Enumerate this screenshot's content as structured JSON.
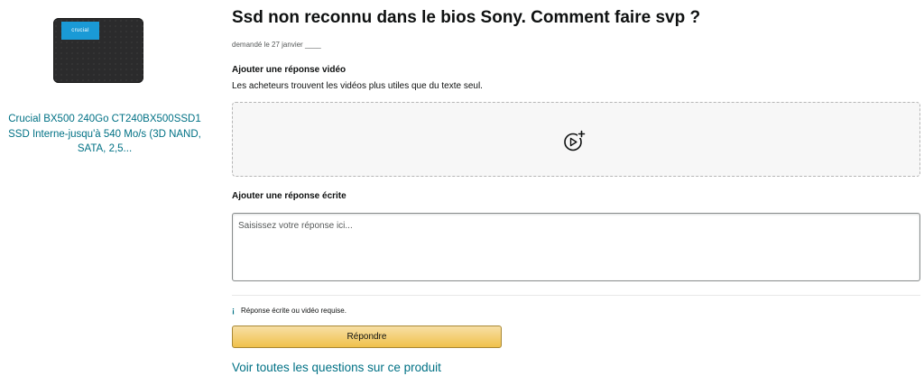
{
  "product": {
    "image_brand_text": "crucial",
    "title": "Crucial BX500 240Go CT240BX500SSD1 SSD Interne-jusqu'à 540 Mo/s (3D NAND, SATA, 2,5..."
  },
  "question": {
    "title": "Ssd non reconnu dans le bios Sony. Comment faire svp ?",
    "asked_date": "demandé le 27 janvier ____"
  },
  "video_answer": {
    "heading": "Ajouter une réponse vidéo",
    "subtext": "Les acheteurs trouvent les vidéos plus utiles que du texte seul.",
    "icon": "video-add-icon"
  },
  "written_answer": {
    "heading": "Ajouter une réponse écrite",
    "placeholder": "Saisissez votre réponse ici..."
  },
  "requirement_note": {
    "icon_glyph": "¡",
    "text": "Réponse écrite ou vidéo requise."
  },
  "respond_button_label": "Répondre",
  "see_all_link": "Voir toutes les questions sur ce produit",
  "colors": {
    "link": "#007185",
    "button_top": "#f7dfa5",
    "button_bottom": "#f0c14b",
    "brand_label": "#1a9ad6"
  }
}
